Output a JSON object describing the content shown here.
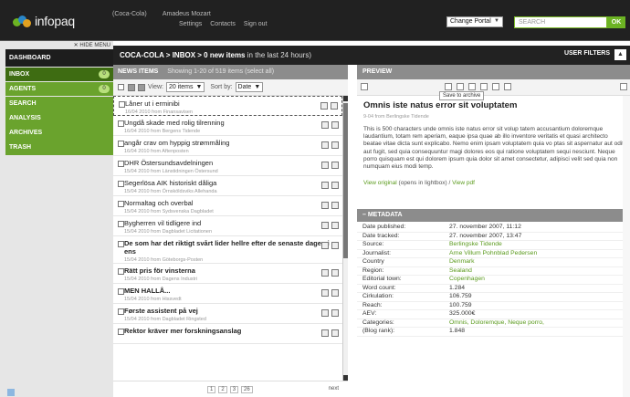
{
  "header": {
    "logo_text": "infopaq",
    "company": "(Coca-Cola)",
    "user": "Amadeus Mozart",
    "links": [
      "Settings",
      "Contacts",
      "Sign out"
    ],
    "portal_select": "Change Portal",
    "search_placeholder": "SEARCH",
    "ok_label": "OK"
  },
  "sidebar": {
    "hide_menu": "✕ HIDE MENU",
    "items": [
      {
        "label": "DASHBOARD",
        "count": ""
      },
      {
        "label": "INBOX",
        "count": "0"
      },
      {
        "label": "AGENTS",
        "count": "0"
      },
      {
        "label": "SEARCH",
        "count": ""
      },
      {
        "label": "ANALYSIS",
        "count": ""
      },
      {
        "label": "ARCHIVES",
        "count": ""
      },
      {
        "label": "TRASH",
        "count": ""
      }
    ]
  },
  "breadcrumb": {
    "path": "COCA-COLA > INBOX > 0 new items",
    "rest": " in the last 24 hours)",
    "user_filters": "USER FILTERS",
    "toggle": "▲"
  },
  "news": {
    "header": "NEWS ITEMS",
    "showing": "Showing 1-20 of 519 items (select all)",
    "view_label": "View:",
    "view_value": "20 items",
    "sort_label": "Sort by:",
    "sort_value": "Date",
    "items": [
      {
        "title": "Låner ut i erminibi",
        "date": "16/04 2010 from Finansavisen",
        "bold": false
      },
      {
        "title": "Ungdå skade med rolig tilrenning",
        "date": "16/04 2010 from Bergens Tidende",
        "bold": false
      },
      {
        "title": "angår crav om hyppig strømmåling",
        "date": "16/04 2010 from Aftenposten",
        "bold": false
      },
      {
        "title": "DHR Östersundsavdelningen",
        "date": "15/04 2010 from Länstidningen Östersund",
        "bold": false
      },
      {
        "title": "Segerlösa AIK historiskt dåliga",
        "date": "15/04 2010 from Örnsköldsviks Allehanda",
        "bold": false
      },
      {
        "title": "Normaltag och overbal",
        "date": "15/04 2010 from Sydsvenska Dagbladet",
        "bold": false
      },
      {
        "title": "Bygherren vil tidligere ind",
        "date": "15/04 2010 from Dagbladet Licitationen",
        "bold": false
      },
      {
        "title": "De som har det riktigt svårt lider hellre efter de senaste dagen i ens",
        "date": "15/04 2010 from Göteborgs-Posten",
        "bold": true
      },
      {
        "title": "Rätt pris för vinsterna",
        "date": "15/04 2010 from Dagens Industri",
        "bold": true
      },
      {
        "title": "MEN HALLÅ...",
        "date": "15/04 2010 from Hissvedt",
        "bold": true
      },
      {
        "title": "Første assistent på vej",
        "date": "15/04 2010 from Dagbladet Ringsted",
        "bold": true
      },
      {
        "title": "Rektor kräver mer forskningsanslag",
        "date": "",
        "bold": true
      }
    ],
    "pages": [
      "1",
      "2",
      "3",
      "26"
    ],
    "next": "next"
  },
  "preview": {
    "header": "PREVIEW",
    "tooltip": "Save to archive",
    "title": "Omnis iste natus error sit voluptatem",
    "source_line": "9-04 from Berlingske Tidende",
    "body": "This is 500 characters unde omnis iste natus error sit volup tatem accusantium doloremque laudantium, totam rem aperiam, eaque ipsa quae ab illo inventore veritatis et quasi architecto beatae vitae dicta sunt explicabo. Nemo enim ipsam voluptatem quia vo ptas sit aspernatur aut odit aut fugit, sed quia consequuntur magi dolores eos qui ratione voluptatem sequi nesciunt. Neque porro quisquam est qui dolorem ipsum quia dolor sit amet consectetur, adipisci velit sed quia non numquam eius modi temp.",
    "view_original": "View original",
    "lightbox": " (opens in lightbox) / ",
    "view_pdf": "View pdf"
  },
  "metadata": {
    "header": "–  METADATA",
    "rows": [
      {
        "key": "Date published:",
        "value": "27. november 2007, 11:12",
        "link": false
      },
      {
        "key": "Date tracked:",
        "value": "27. november 2007, 13:47",
        "link": false
      },
      {
        "key": "Source:",
        "value": "Berlingske Tidende",
        "link": true
      },
      {
        "key": "Journalist:",
        "value": "Arne Villum Pohnblad Pedersen",
        "link": true
      },
      {
        "key": "Country",
        "value": "Denmark",
        "link": true
      },
      {
        "key": "Region:",
        "value": "Sealand",
        "link": true
      },
      {
        "key": "Editorial town:",
        "value": "Copenhagen",
        "link": true
      },
      {
        "key": "Word count:",
        "value": "1.284",
        "link": false
      },
      {
        "key": "Cirkulation:",
        "value": "106.759",
        "link": false
      },
      {
        "key": "Reach:",
        "value": "100.759",
        "link": false
      },
      {
        "key": "AEV:",
        "value": "325.000€",
        "link": false
      },
      {
        "key": "Categories:",
        "value": "Omnis, Doloremque, Neque porro,",
        "link": true
      },
      {
        "key": "(Blog rank):",
        "value": "1.848",
        "link": false
      }
    ]
  }
}
